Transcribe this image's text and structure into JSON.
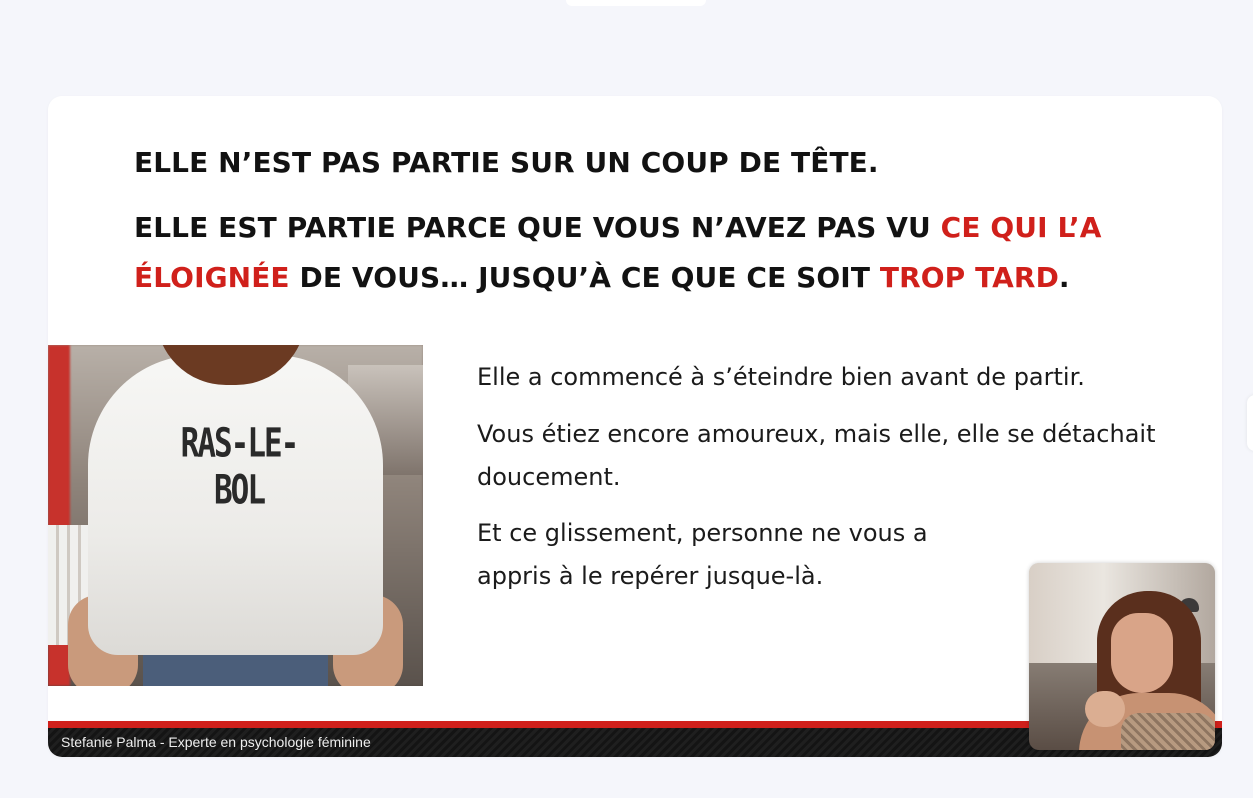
{
  "slide": {
    "headline_line1": "ELLE N’EST PAS PARTIE SUR UN COUP DE TÊTE.",
    "headline_line2": {
      "part1": "ELLE EST PARTIE PARCE QUE VOUS N’AVEZ PAS VU ",
      "accent1": "CE QUI L’A ÉLOIGNÉE",
      "part2": " DE VOUS… JUSQU’À CE QUE CE SOIT ",
      "accent2": "TROP TARD",
      "part3": "."
    },
    "image": {
      "shirt_text": "RAS-LE-BOL"
    },
    "paragraphs": [
      "Elle a commencé à s’éteindre bien avant de partir.",
      "Vous étiez encore amoureux, mais elle, elle se détachait doucement.",
      "Et ce glissement, personne ne vous a appris à le repérer jusque-là."
    ],
    "footer": "Stefanie Palma - Experte en psychologie féminine"
  },
  "colors": {
    "accent": "#d0201b",
    "text": "#121212",
    "background": "#f5f6fb",
    "slide_background": "#ffffff",
    "footer_bar": "#141414"
  }
}
